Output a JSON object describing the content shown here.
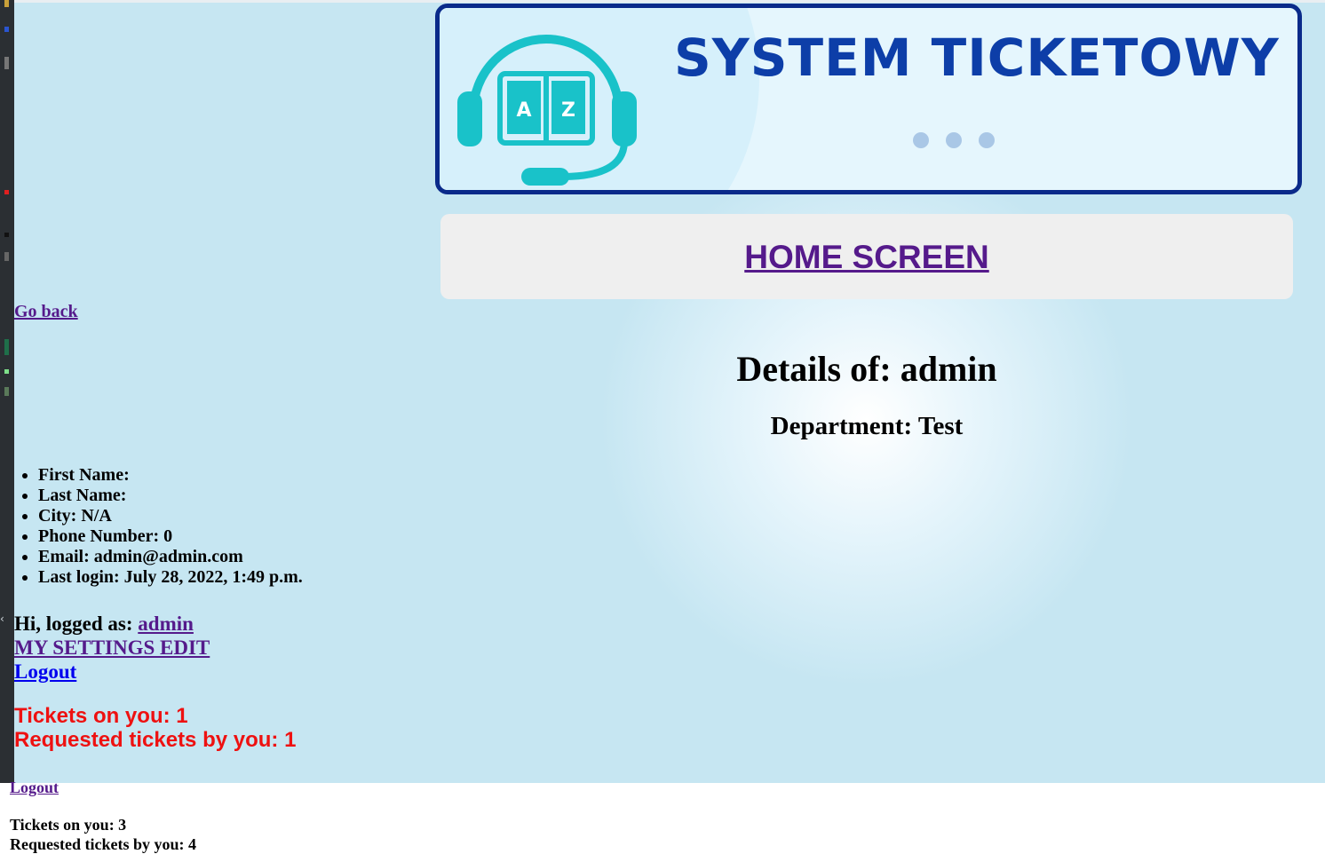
{
  "banner": {
    "title": "SYSTEM TICKETOWY",
    "logo_letters": [
      "A",
      "Z"
    ],
    "colors": {
      "border": "#0a2a8a",
      "brand_text": "#0d3ea8",
      "logo": "#19c2c9"
    }
  },
  "nav": {
    "home_label": "HOME SCREEN",
    "go_back_label": "Go back"
  },
  "details": {
    "title": "Details of: admin",
    "department": "Department: Test",
    "fields": [
      "First Name:",
      "Last Name:",
      "City: N/A",
      "Phone Number: 0",
      "Email: admin@admin.com",
      "Last login: July 28, 2022, 1:49 p.m."
    ]
  },
  "user": {
    "greeting": "Hi, logged as:",
    "username": "admin",
    "settings_label": "MY SETTINGS EDIT",
    "logout_label": "Logout"
  },
  "stats": {
    "tickets_on_you": "Tickets on you: 1",
    "requested_by_you": "Requested tickets by you: 1",
    "color": "#ee1111"
  },
  "lower_page": {
    "logout_label": "Logout",
    "tickets_on_you": "Tickets on you: 3",
    "requested_by_you": "Requested tickets by you: 4"
  }
}
